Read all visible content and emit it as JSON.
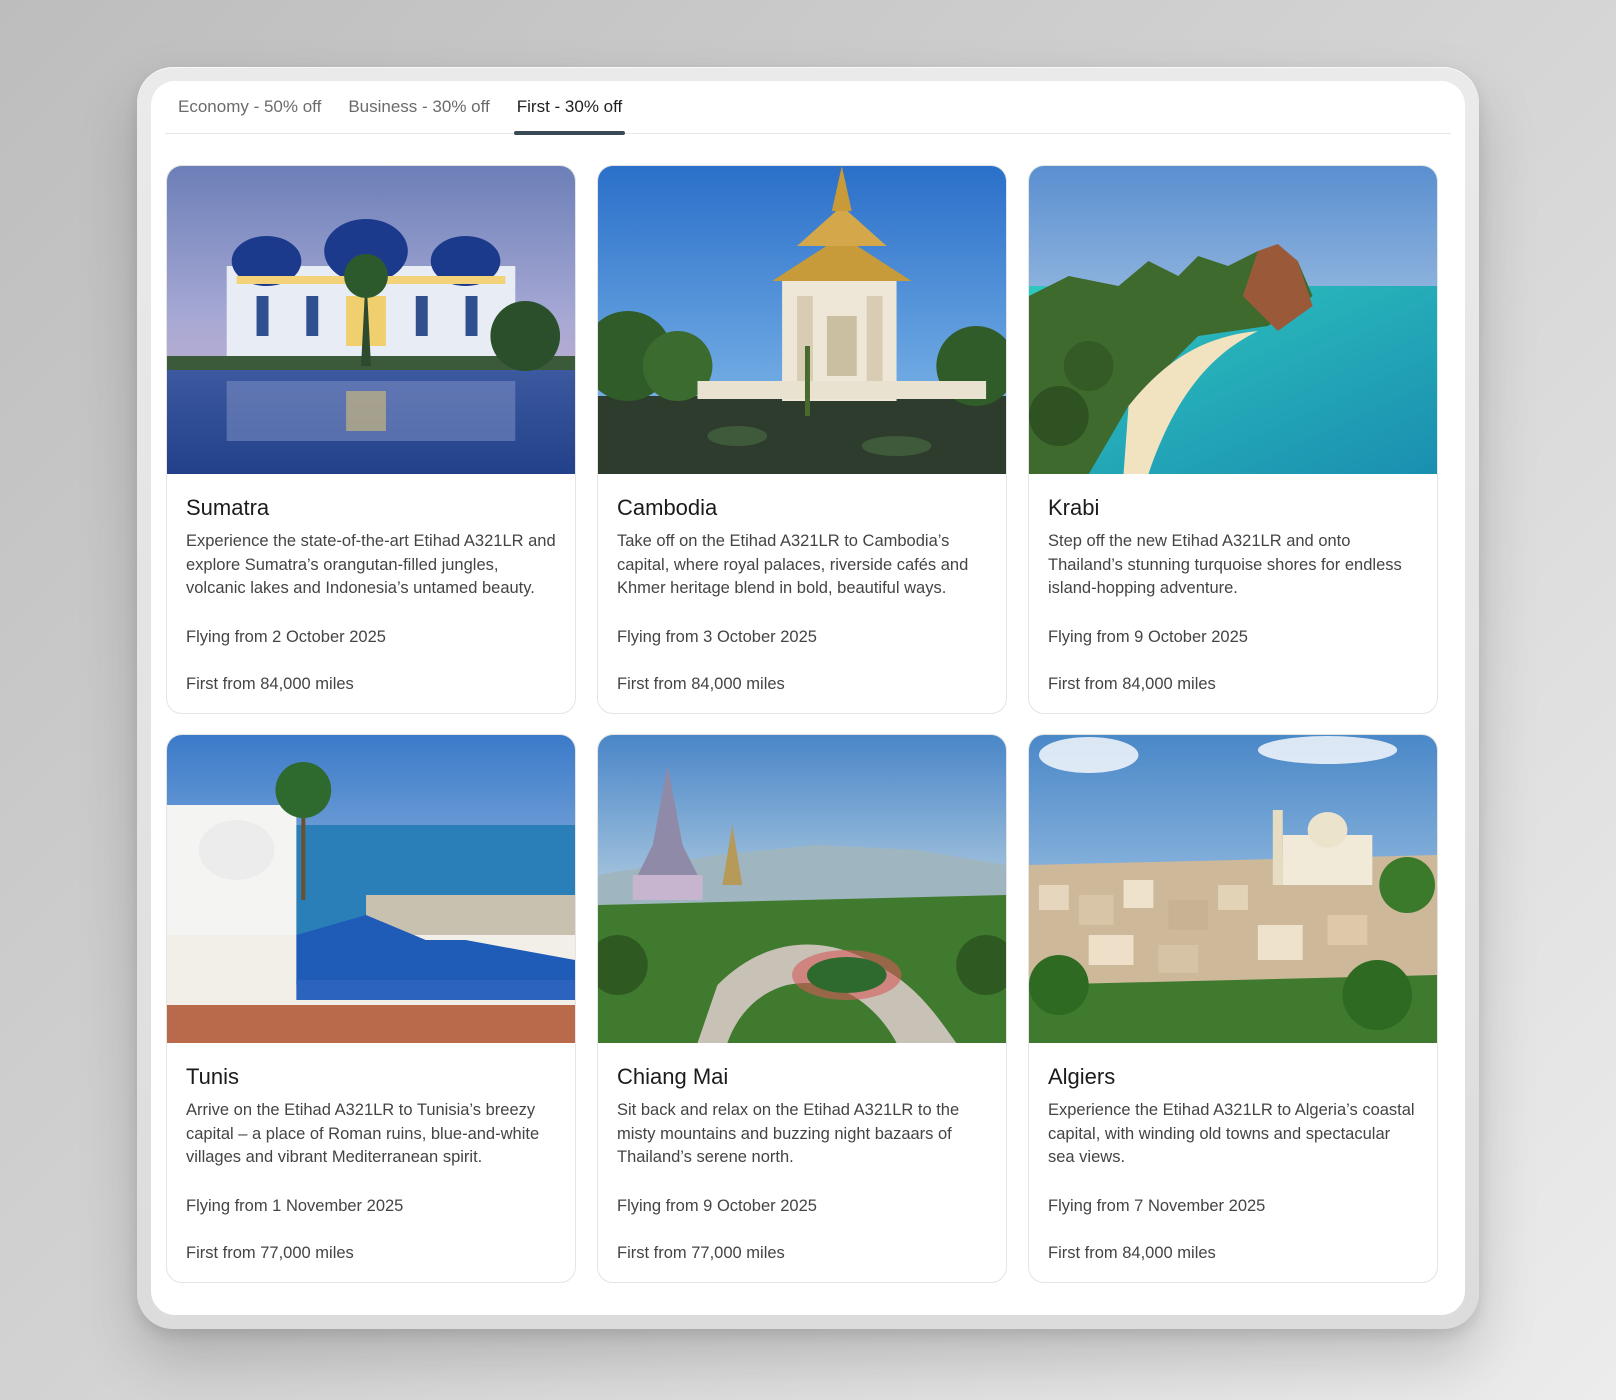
{
  "tabs": [
    {
      "label": "Economy - 50% off",
      "active": false
    },
    {
      "label": "Business - 30% off",
      "active": false
    },
    {
      "label": "First - 30% off",
      "active": true
    }
  ],
  "cards": [
    {
      "title": "Sumatra",
      "description": "Experience the state-of-the-art Etihad A321LR and explore Sumatra’s orangutan-filled jungles, volcanic lakes and Indonesia’s untamed beauty.",
      "date": "Flying from 2 October 2025",
      "price": "First from 84,000 miles",
      "image": "sumatra-mosque-photo"
    },
    {
      "title": "Cambodia",
      "description": "Take off on the Etihad A321LR to Cambodia’s capital, where royal palaces, riverside cafés and Khmer heritage blend in bold, beautiful ways.",
      "date": "Flying from 3 October 2025",
      "price": "First from 84,000 miles",
      "image": "cambodia-pagoda-photo"
    },
    {
      "title": "Krabi",
      "description": "Step off the new Etihad A321LR and onto Thailand’s stunning turquoise shores for endless island-hopping adventure.",
      "date": "Flying from 9 October 2025",
      "price": "First from 84,000 miles",
      "image": "krabi-beach-photo"
    },
    {
      "title": "Tunis",
      "description": "Arrive on the Etihad A321LR to Tunisia’s breezy capital – a place of Roman ruins, blue-and-white villages and vibrant Mediterranean spirit.",
      "date": "Flying from 1 November 2025",
      "price": "First from 77,000 miles",
      "image": "tunis-harbour-photo"
    },
    {
      "title": "Chiang Mai",
      "description": "Sit back and relax on the Etihad A321LR to the misty mountains and buzzing night bazaars of Thailand’s serene north.",
      "date": "Flying from 9 October 2025",
      "price": "First from 77,000 miles",
      "image": "chiang-mai-pagoda-photo"
    },
    {
      "title": "Algiers",
      "description": "Experience the Etihad A321LR to Algeria’s coastal capital, with winding old towns and spectacular sea views.",
      "date": "Flying from 7 November 2025",
      "price": "First from 84,000 miles",
      "image": "algiers-city-photo"
    }
  ]
}
